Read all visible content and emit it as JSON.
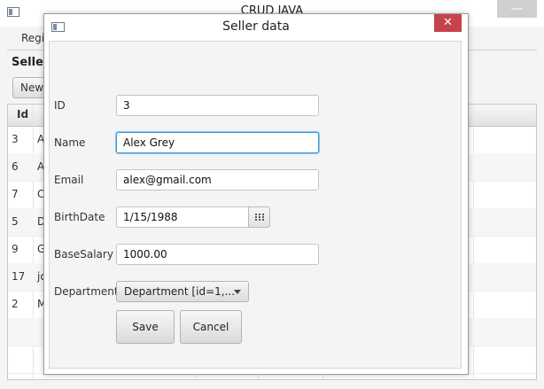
{
  "main_window": {
    "title": "CRUD JAVA",
    "menu_label": "Regi",
    "section_title": "Seller",
    "new_button_label": "New",
    "table": {
      "columns": [
        "Id"
      ],
      "rows": [
        {
          "id": "3",
          "name": "A"
        },
        {
          "id": "6",
          "name": "A"
        },
        {
          "id": "7",
          "name": "C"
        },
        {
          "id": "5",
          "name": "D"
        },
        {
          "id": "9",
          "name": "G"
        },
        {
          "id": "17",
          "name": "jo"
        },
        {
          "id": "2",
          "name": "M"
        }
      ]
    }
  },
  "dialog": {
    "title": "Seller data",
    "close_icon": "close-icon",
    "fields": {
      "id": {
        "label": "ID",
        "value": "3"
      },
      "name": {
        "label": "Name",
        "value": "Alex Grey"
      },
      "email": {
        "label": "Email",
        "value": "alex@gmail.com"
      },
      "birthdate": {
        "label": "BirthDate",
        "value": "1/15/1988"
      },
      "base_salary": {
        "label": "BaseSalary",
        "value": "1000.00"
      },
      "department": {
        "label": "Department",
        "value": "Department [id=1,..."
      }
    },
    "save_label": "Save",
    "cancel_label": "Cancel"
  },
  "colors": {
    "close_button": "#c7434a",
    "focus_border": "#3b98d6"
  }
}
